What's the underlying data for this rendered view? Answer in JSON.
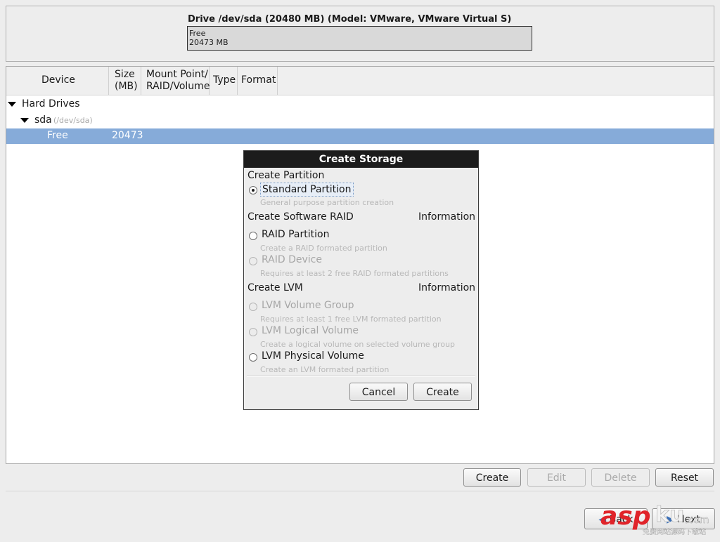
{
  "drive": {
    "title": "Drive /dev/sda (20480 MB) (Model: VMware, VMware Virtual S)",
    "bar_label": "Free",
    "bar_size": "20473 MB"
  },
  "tree": {
    "columns": {
      "device": "Device",
      "size_1": "Size",
      "size_2": "(MB)",
      "mount_1": "Mount Point/",
      "mount_2": "RAID/Volume",
      "type": "Type",
      "format": "Format"
    },
    "rows": {
      "hard_drives": "Hard Drives",
      "sda": "sda",
      "sda_path": "(/dev/sda)",
      "free": "Free",
      "free_size": "20473"
    },
    "selection_color": "#86abd9"
  },
  "dialog": {
    "title": "Create Storage",
    "section_partition": "Create Partition",
    "standard_partition": "Standard Partition",
    "standard_partition_hint": "General purpose partition creation",
    "section_raid": "Create Software RAID",
    "info_raid": "Information",
    "raid_partition": "RAID Partition",
    "raid_partition_hint": "Create a RAID formated partition",
    "raid_device": "RAID Device",
    "raid_device_hint": "Requires at least 2 free RAID formated partitions",
    "section_lvm": "Create LVM",
    "info_lvm": "Information",
    "lvm_volume_group": "LVM Volume Group",
    "lvm_volume_group_hint": "Requires at least 1 free LVM formated partition",
    "lvm_logical_volume": "LVM Logical Volume",
    "lvm_logical_volume_hint": "Create a logical volume on selected volume group",
    "lvm_physical_volume": "LVM Physical Volume",
    "lvm_physical_volume_hint": "Create an LVM formated partition",
    "cancel_label": "Cancel",
    "create_label": "Create"
  },
  "toolbar": {
    "create_label": "Create",
    "edit_label": "Edit",
    "delete_label": "Delete",
    "reset_label": "Reset"
  },
  "nav": {
    "back_label": "Back",
    "next_label": "Next"
  },
  "watermark": {
    "brand": "asp",
    "brand_suffix": "ku",
    "domain": ".com",
    "caption": "免费网站源码下载站"
  }
}
